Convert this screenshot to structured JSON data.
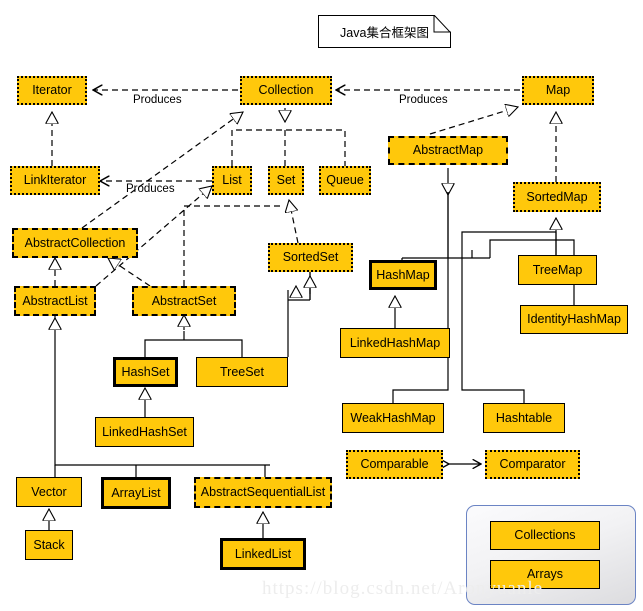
{
  "diagram": {
    "title_note": "Java集合框架图",
    "watermark": "https://blog.csdn.net/Aronyuanle",
    "colors": {
      "node_fill": "#FFC80B",
      "node_border": "#000000",
      "panel_border": "#6b84c4",
      "background": "#ffffff"
    },
    "edge_labels": {
      "produces_top": "Produces",
      "produces_bottom": "Produces"
    },
    "nodes": [
      {
        "id": "iterator",
        "label": "Iterator",
        "style": "dotted"
      },
      {
        "id": "collection",
        "label": "Collection",
        "style": "dotted"
      },
      {
        "id": "map",
        "label": "Map",
        "style": "dotted"
      },
      {
        "id": "linkiterator",
        "label": "LinkIterator",
        "style": "dotted"
      },
      {
        "id": "list",
        "label": "List",
        "style": "dotted"
      },
      {
        "id": "set",
        "label": "Set",
        "style": "dotted"
      },
      {
        "id": "queue",
        "label": "Queue",
        "style": "dotted"
      },
      {
        "id": "abstractmap",
        "label": "AbstractMap",
        "style": "dashed"
      },
      {
        "id": "sortedmap",
        "label": "SortedMap",
        "style": "dotted"
      },
      {
        "id": "abstractcollection",
        "label": "AbstractCollection",
        "style": "dashed"
      },
      {
        "id": "sortedset",
        "label": "SortedSet",
        "style": "dotted"
      },
      {
        "id": "hashmap",
        "label": "HashMap",
        "style": "thick"
      },
      {
        "id": "treemap",
        "label": "TreeMap",
        "style": "solid"
      },
      {
        "id": "abstractlist",
        "label": "AbstractList",
        "style": "dashed"
      },
      {
        "id": "abstractset",
        "label": "AbstractSet",
        "style": "dashed"
      },
      {
        "id": "identityhashmap",
        "label": "IdentityHashMap",
        "style": "solid"
      },
      {
        "id": "linkedhashmap",
        "label": "LinkedHashMap",
        "style": "solid"
      },
      {
        "id": "hashset",
        "label": "HashSet",
        "style": "thick"
      },
      {
        "id": "treeset",
        "label": "TreeSet",
        "style": "solid"
      },
      {
        "id": "linkedhashset",
        "label": "LinkedHashSet",
        "style": "solid"
      },
      {
        "id": "weakhashmap",
        "label": "WeakHashMap",
        "style": "solid"
      },
      {
        "id": "hashtable",
        "label": "Hashtable",
        "style": "solid"
      },
      {
        "id": "comparable",
        "label": "Comparable",
        "style": "dotted"
      },
      {
        "id": "comparator",
        "label": "Comparator",
        "style": "dotted"
      },
      {
        "id": "vector",
        "label": "Vector",
        "style": "solid"
      },
      {
        "id": "arraylist",
        "label": "ArrayList",
        "style": "thick"
      },
      {
        "id": "abstractsequentiallist",
        "label": "AbstractSequentialList",
        "style": "dashed"
      },
      {
        "id": "stack",
        "label": "Stack",
        "style": "solid"
      },
      {
        "id": "linkedlist",
        "label": "LinkedList",
        "style": "thick"
      },
      {
        "id": "collections",
        "label": "Collections",
        "style": "solid"
      },
      {
        "id": "arrays",
        "label": "Arrays",
        "style": "solid"
      }
    ]
  }
}
